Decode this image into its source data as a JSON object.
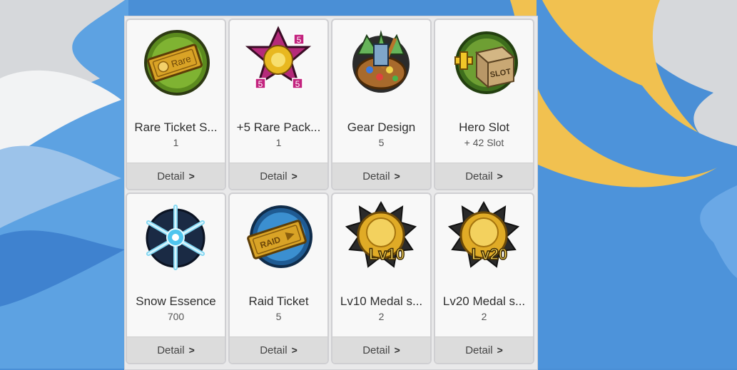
{
  "items": [
    {
      "name": "Rare Ticket S...",
      "qty": "1",
      "detail": "Detail",
      "icon": "rare-ticket-icon",
      "ticket_text": "Rare"
    },
    {
      "name": "+5 Rare Pack...",
      "qty": "1",
      "detail": "Detail",
      "icon": "rare-pack-icon",
      "badge": "5"
    },
    {
      "name": "Gear Design",
      "qty": "5",
      "detail": "Detail",
      "icon": "gear-design-icon"
    },
    {
      "name": "Hero Slot",
      "qty": "+ 42 Slot",
      "detail": "Detail",
      "icon": "hero-slot-icon",
      "box_text": "SLOT"
    },
    {
      "name": "Snow Essence",
      "qty": "700",
      "detail": "Detail",
      "icon": "snow-essence-icon"
    },
    {
      "name": "Raid Ticket",
      "qty": "5",
      "detail": "Detail",
      "icon": "raid-ticket-icon",
      "ticket_text": "RAID"
    },
    {
      "name": "Lv10 Medal s...",
      "qty": "2",
      "detail": "Detail",
      "icon": "lv10-medal-icon",
      "level_text": "Lv10"
    },
    {
      "name": "Lv20 Medal s...",
      "qty": "2",
      "detail": "Detail",
      "icon": "lv20-medal-icon",
      "level_text": "Lv20"
    }
  ],
  "colors": {
    "background_blue": "#4a8fd6",
    "moon_yellow": "#f1c150",
    "card_bg": "#f8f8f8",
    "detail_bar": "#dcdcdc"
  }
}
